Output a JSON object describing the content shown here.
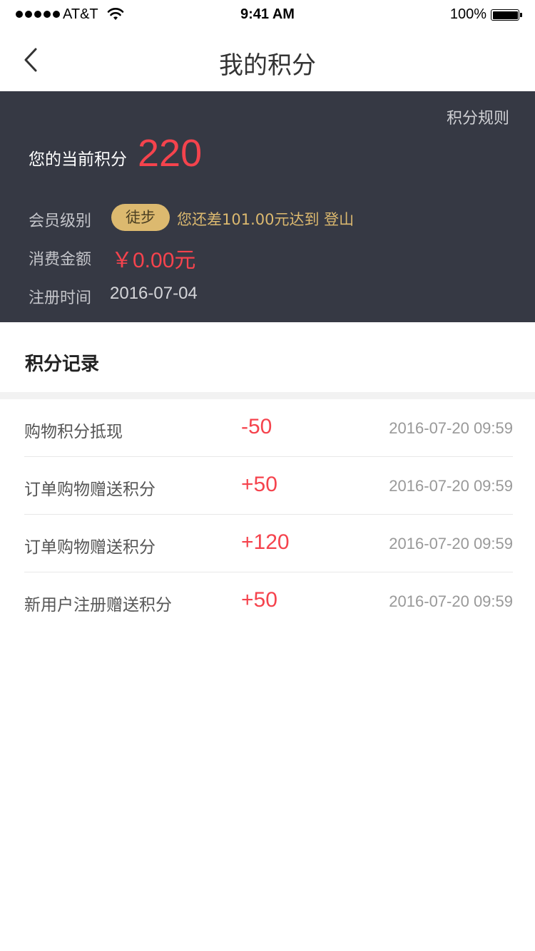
{
  "status_bar": {
    "carrier": "AT&T",
    "time": "9:41 AM",
    "battery": "100%"
  },
  "nav": {
    "title": "我的积分",
    "back_icon": "chevron-left-icon"
  },
  "summary": {
    "rules_link": "积分规则",
    "points_label": "您的当前积分",
    "points_value": "220",
    "level_label": "会员级别",
    "level_badge": "徒步",
    "level_hint": "您还差101.00元达到 登山",
    "spend_label": "消费金额",
    "spend_value": "￥0.00元",
    "register_label": "注册时间",
    "register_value": "2016-07-04"
  },
  "records": {
    "title": "积分记录",
    "items": [
      {
        "desc": "购物积分抵现",
        "amount": "-50",
        "time": "2016-07-20 09:59"
      },
      {
        "desc": "订单购物赠送积分",
        "amount": "+50",
        "time": "2016-07-20 09:59"
      },
      {
        "desc": "订单购物赠送积分",
        "amount": "+120",
        "time": "2016-07-20 09:59"
      },
      {
        "desc": "新用户注册赠送积分",
        "amount": "+50",
        "time": "2016-07-20 09:59"
      }
    ]
  },
  "colors": {
    "panel_bg": "#363944",
    "accent_red": "#f5434d",
    "gold": "#dcb96f"
  }
}
